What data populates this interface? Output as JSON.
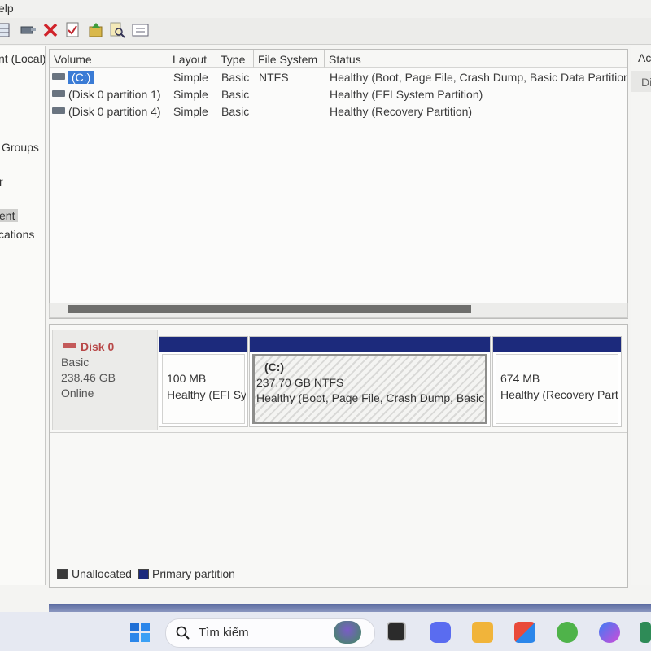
{
  "menubar": {
    "help_label": "elp"
  },
  "toolbar": {
    "icons": [
      "disk-grid-icon",
      "connect-icon",
      "delete-icon",
      "check-properties-icon",
      "import-icon",
      "search-document-icon",
      "settings-list-icon"
    ]
  },
  "left_pane": {
    "items": [
      {
        "label": "nt (Local)"
      },
      {
        "label": "Groups"
      },
      {
        "label": "r"
      },
      {
        "label": "ent"
      },
      {
        "label": "cations"
      }
    ]
  },
  "action_pane": {
    "header": "Ac",
    "item": "Di"
  },
  "volume_list": {
    "columns": [
      "Volume",
      "Layout",
      "Type",
      "File System",
      "Status"
    ],
    "rows": [
      {
        "volume": "(C:)",
        "layout": "Simple",
        "type": "Basic",
        "fs": "NTFS",
        "status": "Healthy (Boot, Page File, Crash Dump, Basic Data Partition"
      },
      {
        "volume": "(Disk 0 partition 1)",
        "layout": "Simple",
        "type": "Basic",
        "fs": "",
        "status": "Healthy (EFI System Partition)"
      },
      {
        "volume": "(Disk 0 partition 4)",
        "layout": "Simple",
        "type": "Basic",
        "fs": "",
        "status": "Healthy (Recovery Partition)"
      }
    ]
  },
  "disk": {
    "name": "Disk 0",
    "type": "Basic",
    "size": "238.46 GB",
    "state": "Online",
    "partitions": [
      {
        "label": "",
        "size": "100 MB",
        "status": "Healthy (EFI Sy"
      },
      {
        "label": "(C:)",
        "size": "237.70 GB NTFS",
        "status": "Healthy (Boot, Page File, Crash Dump, Basic I"
      },
      {
        "label": "",
        "size": "674 MB",
        "status": "Healthy (Recovery Part"
      }
    ]
  },
  "legend": {
    "unallocated": "Unallocated",
    "primary": "Primary partition",
    "unallocated_color": "#3a3a3a",
    "primary_color": "#1c2a7c"
  },
  "taskbar": {
    "search_text": "Tìm kiếm",
    "icons": [
      "windows-start-icon",
      "search-icon",
      "copilot-icon",
      "task-view-icon",
      "chat-icon",
      "file-explorer-icon",
      "store-icon",
      "app-icon",
      "messenger-icon"
    ]
  }
}
